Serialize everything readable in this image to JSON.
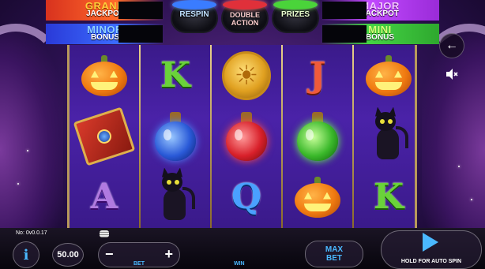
{
  "jackpots": {
    "grand": {
      "line1": "GRAND",
      "line2": "JACKPOT"
    },
    "minor": {
      "line1": "MINOR",
      "line2": "BONUS"
    },
    "major": {
      "line1": "MAJOR",
      "line2": "JACKPOT"
    },
    "mini": {
      "line1": "MINI",
      "line2": "BONUS"
    }
  },
  "features": {
    "respin": "RESPIN",
    "double_action": "DOUBLE ACTION",
    "prizes": "PRIZES"
  },
  "reels": [
    [
      "pumpkin",
      "spellbook",
      "A"
    ],
    [
      "K",
      "blue-potion",
      "black-cat"
    ],
    [
      "sun-coin",
      "red-potion",
      "Q"
    ],
    [
      "J",
      "green-potion",
      "pumpkin"
    ],
    [
      "pumpkin",
      "black-cat",
      "K"
    ]
  ],
  "colors": {
    "reel_bg": "#4a22a8",
    "accent": "#4ab8ff",
    "grand": "#ffcf3a",
    "minor": "#8fd0ff",
    "major": "#f3c6ff",
    "mini": "#d7ff7a"
  },
  "controls": {
    "back_icon": "arrow-left-icon",
    "sound_icon": "speaker-muted-icon",
    "info_label": "i",
    "bet_value": "50.00",
    "bet_minus": "−",
    "bet_plus": "+",
    "bet_label": "BET",
    "win_label": "WIN",
    "max_bet_label": "MAX BET",
    "spin_label": "HOLD FOR AUTO SPIN"
  },
  "status": {
    "version": "No: 0v0.0.17"
  }
}
